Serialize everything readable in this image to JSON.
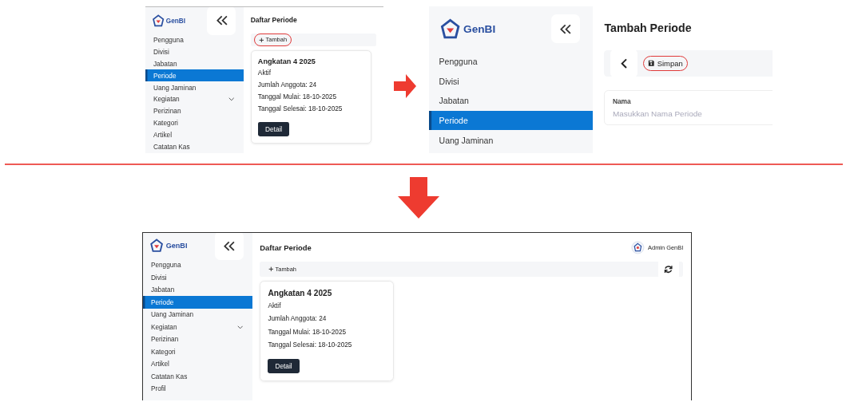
{
  "screens": [
    {
      "kind": "list",
      "logo": "GenBI",
      "sidebar": [
        {
          "label": "Pengguna",
          "selected": false,
          "kind": "link"
        },
        {
          "label": "Divisi",
          "selected": false,
          "kind": "link"
        },
        {
          "label": "Jabatan",
          "selected": false,
          "kind": "link"
        },
        {
          "label": "Periode",
          "selected": true,
          "kind": "link"
        },
        {
          "label": "Uang Jaminan",
          "selected": false,
          "kind": "link"
        },
        {
          "label": "Kegiatan",
          "selected": false,
          "kind": "group"
        },
        {
          "label": "Perizinan",
          "selected": false,
          "kind": "link"
        },
        {
          "label": "Kategori",
          "selected": false,
          "kind": "link"
        },
        {
          "label": "Artikel",
          "selected": false,
          "kind": "link"
        },
        {
          "label": "Catatan Kas",
          "selected": false,
          "kind": "link"
        }
      ],
      "title": "Daftar Periode",
      "add_button": {
        "label": "Tambah",
        "highlighted": true
      },
      "cards": [
        {
          "title": "Angkatan 4 2025",
          "status": "Aktif",
          "lines": [
            "Jumlah Anggota: 24",
            "Tanggal Mulai: 18-10-2025",
            "Tanggal Selesai: 18-10-2025"
          ],
          "button": "Detail"
        }
      ]
    },
    {
      "kind": "form",
      "logo": "GenBI",
      "sidebar": [
        {
          "label": "Pengguna",
          "selected": false,
          "kind": "link"
        },
        {
          "label": "Divisi",
          "selected": false,
          "kind": "link"
        },
        {
          "label": "Jabatan",
          "selected": false,
          "kind": "link"
        },
        {
          "label": "Periode",
          "selected": true,
          "kind": "link"
        },
        {
          "label": "Uang Jaminan",
          "selected": false,
          "kind": "link"
        }
      ],
      "title": "Tambah Periode",
      "save_button": {
        "label": "Simpan",
        "highlighted": true
      },
      "field": {
        "label": "Nama",
        "placeholder": "Masukkan Nama Periode"
      }
    },
    {
      "kind": "list",
      "logo": "GenBI",
      "sidebar": [
        {
          "label": "Pengguna",
          "selected": false,
          "kind": "link"
        },
        {
          "label": "Divisi",
          "selected": false,
          "kind": "link"
        },
        {
          "label": "Jabatan",
          "selected": false,
          "kind": "link"
        },
        {
          "label": "Periode",
          "selected": true,
          "kind": "link"
        },
        {
          "label": "Uang Jaminan",
          "selected": false,
          "kind": "link"
        },
        {
          "label": "Kegiatan",
          "selected": false,
          "kind": "group"
        },
        {
          "label": "Perizinan",
          "selected": false,
          "kind": "link"
        },
        {
          "label": "Kategori",
          "selected": false,
          "kind": "link"
        },
        {
          "label": "Artikel",
          "selected": false,
          "kind": "link"
        },
        {
          "label": "Catatan Kas",
          "selected": false,
          "kind": "link"
        },
        {
          "label": "Profil",
          "selected": false,
          "kind": "link"
        }
      ],
      "title": "Daftar Periode",
      "user": {
        "name": "Admin GenBI"
      },
      "add_button": {
        "label": "Tambah",
        "highlighted": false
      },
      "refresh_button": true,
      "cards": [
        {
          "title": "Angkatan 4 2025",
          "status": "Aktif",
          "lines": [
            "Jumlah Anggota: 24",
            "Tanggal Mulai: 18-10-2025",
            "Tanggal Selesai: 18-10-2025"
          ],
          "button": "Detail"
        }
      ]
    }
  ]
}
